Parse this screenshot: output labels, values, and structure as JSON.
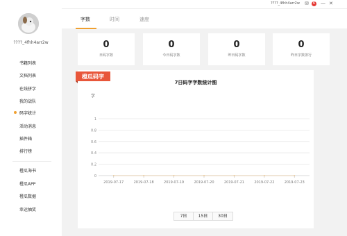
{
  "titlebar": {
    "username": "????_4fhh4arr2w",
    "mail_icon": "mail-icon",
    "badge": "6",
    "minimize_icon": "minimize-icon",
    "close_icon": "close-icon"
  },
  "sidebar": {
    "username": "????_4fhh4arr2w",
    "avatar_icon": "avatar-image",
    "items": [
      {
        "label": "书籍列表"
      },
      {
        "label": "文档列表"
      },
      {
        "label": "在线拼字"
      },
      {
        "label": "我的战队"
      },
      {
        "label": "码字统计",
        "active": true
      },
      {
        "label": "活动消息"
      },
      {
        "label": "插件箱"
      },
      {
        "label": "排行榜"
      }
    ],
    "items2": [
      {
        "label": "橙瓜海书"
      },
      {
        "label": "橙瓜APP"
      },
      {
        "label": "橙瓜数据"
      },
      {
        "label": "幸运抽奖"
      }
    ]
  },
  "tabs": [
    {
      "label": "字数",
      "active": true
    },
    {
      "label": "时间"
    },
    {
      "label": "速度"
    }
  ],
  "stats": [
    {
      "value": "0",
      "label": "日码字数"
    },
    {
      "value": "0",
      "label": "今日码字数"
    },
    {
      "value": "0",
      "label": "昨日码字数"
    },
    {
      "value": "0",
      "label": "昨日字数排行"
    }
  ],
  "panel": {
    "brand": "橙瓜码字",
    "range_buttons": [
      "7日",
      "15日",
      "30日"
    ]
  },
  "chart_data": {
    "type": "line",
    "title": "7日码字字数统计图",
    "ylabel": "字",
    "xlabel": "",
    "categories": [
      "2019-07-17",
      "2019-07-18",
      "2019-07-19",
      "2019-07-20",
      "2019-07-21",
      "2019-07-22",
      "2019-07-23"
    ],
    "y_ticks": [
      0,
      0.2,
      0.4,
      0.6,
      0.8,
      1
    ],
    "ylim": [
      0,
      1
    ],
    "series": [
      {
        "values": [
          0,
          0,
          0,
          0,
          0,
          0,
          0
        ]
      }
    ],
    "grid": true,
    "colors": {
      "grid": "#e6e6e6",
      "axis": "#cccccc",
      "line": "#f0a030"
    }
  }
}
